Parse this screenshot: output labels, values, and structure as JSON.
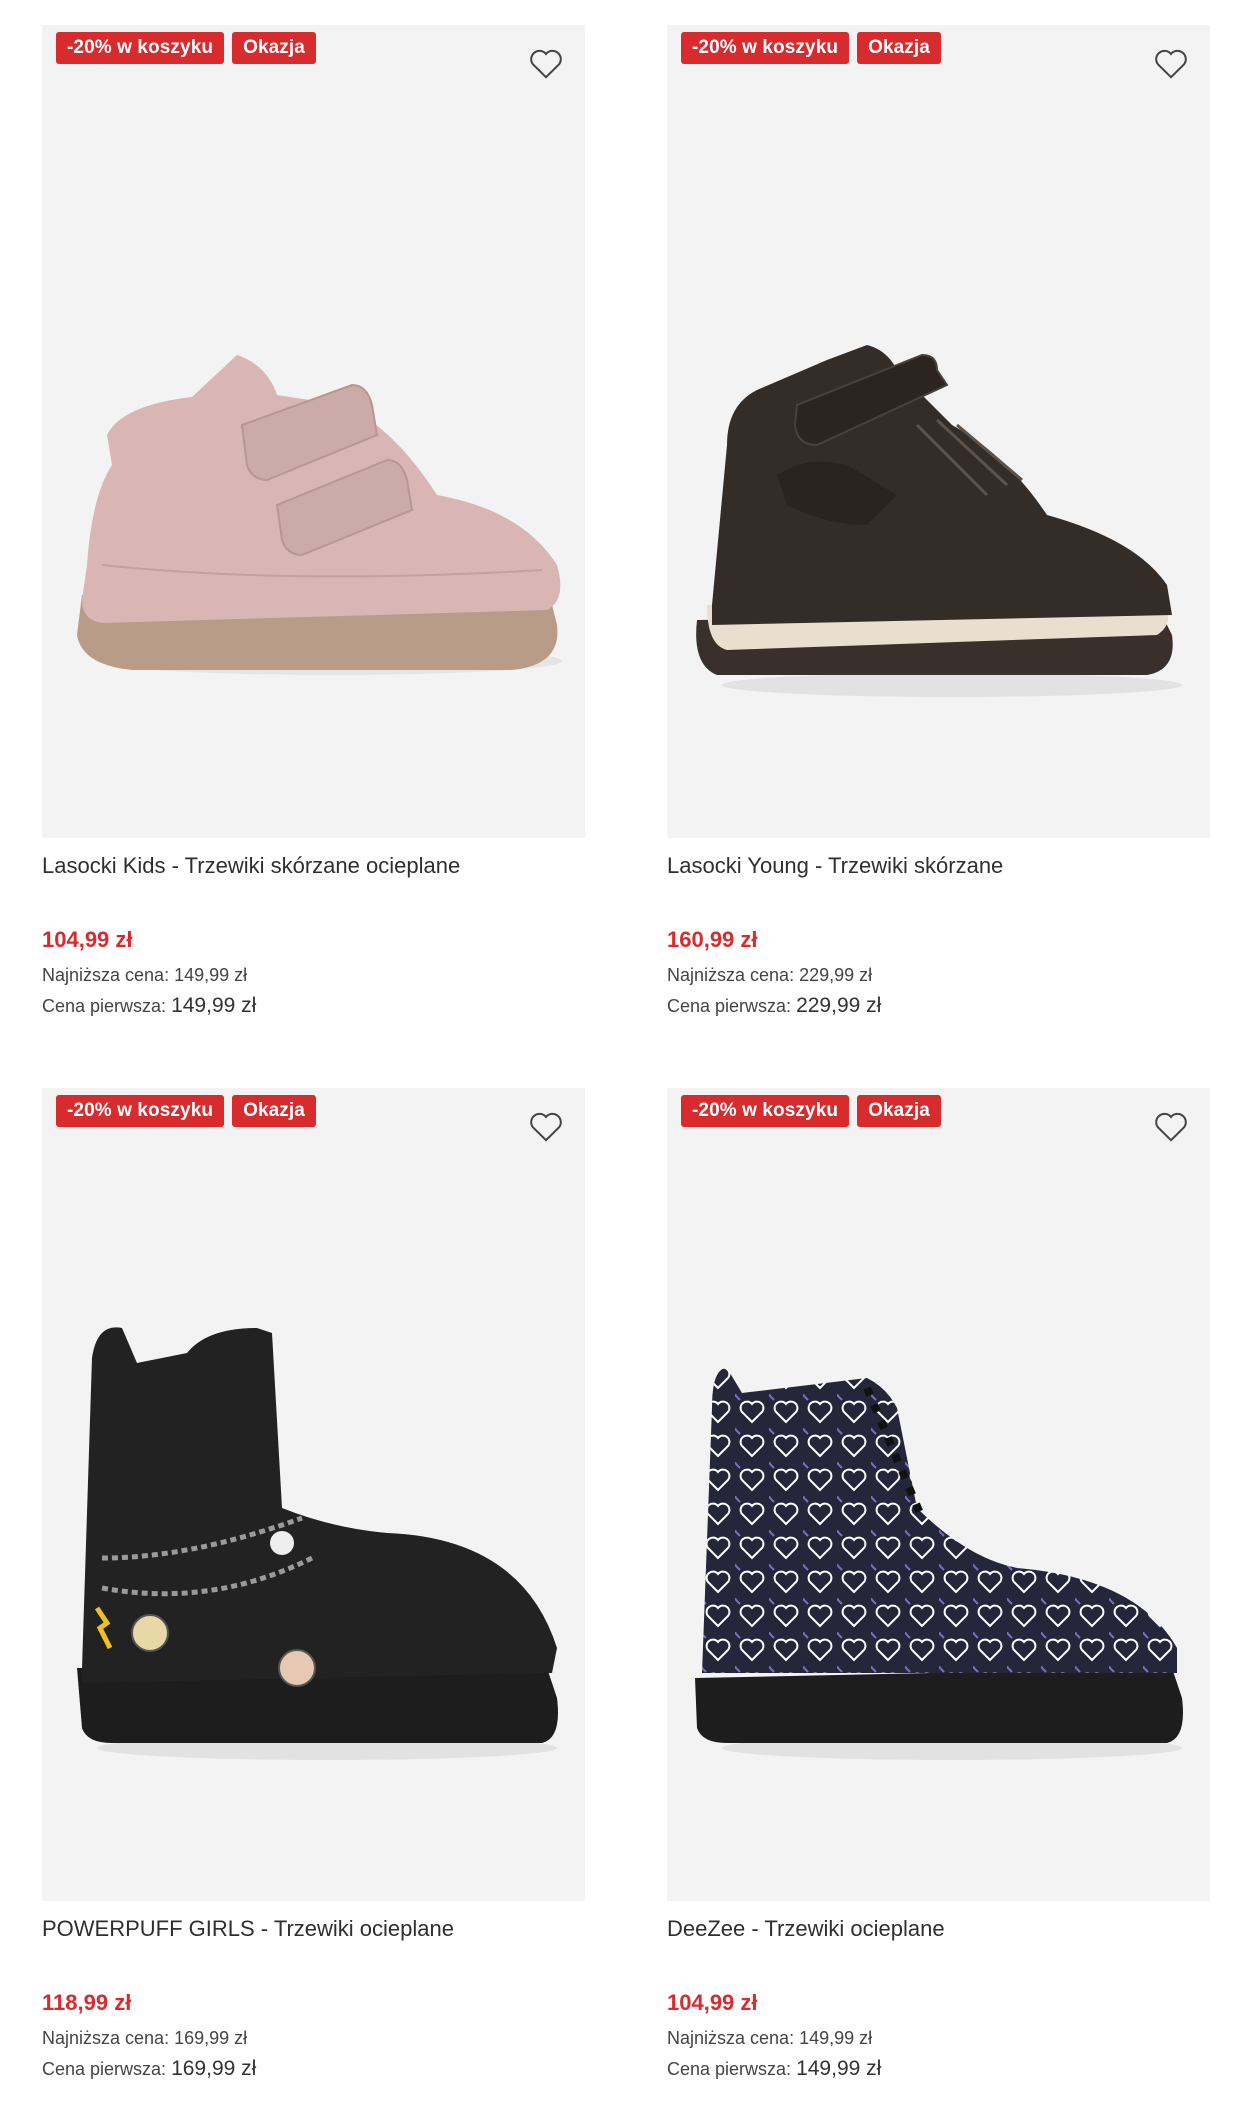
{
  "products": [
    {
      "badges": [
        "-20% w koszyku",
        "Okazja"
      ],
      "title": "Lasocki Kids - Trzewiki skórzane ocieplane",
      "price": "104,99 zł",
      "lowest_label": "Najniższa cena:",
      "lowest_value": "149,99 zł",
      "first_label": "Cena pierwsza:",
      "first_value": "149,99 zł",
      "image": "pink-velcro-boot"
    },
    {
      "badges": [
        "-20% w koszyku",
        "Okazja"
      ],
      "title": "Lasocki Young - Trzewiki skórzane",
      "price": "160,99 zł",
      "lowest_label": "Najniższa cena:",
      "lowest_value": "229,99 zł",
      "first_label": "Cena pierwsza:",
      "first_value": "229,99 zł",
      "image": "dark-brown-sneaker-boot"
    },
    {
      "badges": [
        "-20% w koszyku",
        "Okazja"
      ],
      "title": "POWERPUFF GIRLS - Trzewiki ocieplane",
      "price": "118,99 zł",
      "lowest_label": "Najniższa cena:",
      "lowest_value": "169,99 zł",
      "first_label": "Cena pierwsza:",
      "first_value": "169,99 zł",
      "image": "black-chain-boot"
    },
    {
      "badges": [
        "-20% w koszyku",
        "Okazja"
      ],
      "title": "DeeZee - Trzewiki ocieplane",
      "price": "104,99 zł",
      "lowest_label": "Najniższa cena:",
      "lowest_value": "149,99 zł",
      "first_label": "Cena pierwsza:",
      "first_value": "149,99 zł",
      "image": "heart-print-boot"
    }
  ],
  "icons": {
    "wishlist": "heart-outline-icon"
  },
  "colors": {
    "accent": "#d72b2e",
    "tile_bg": "#f3f3f3"
  }
}
